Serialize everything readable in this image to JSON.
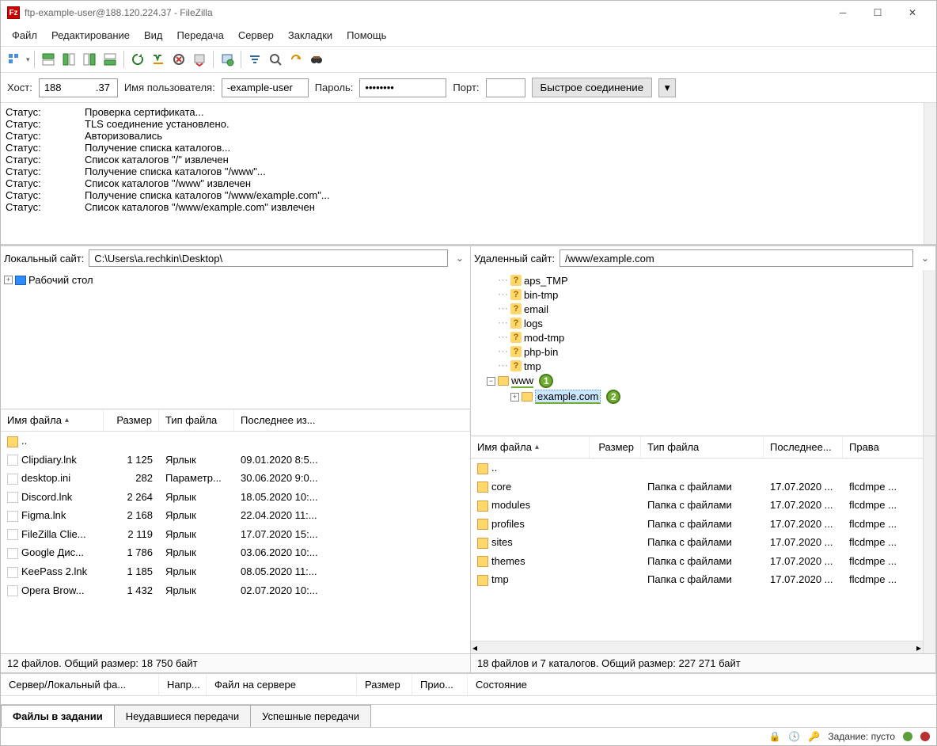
{
  "title": "ftp-example-user@188.120.224.37 - FileZilla",
  "menu": [
    "Файл",
    "Редактирование",
    "Вид",
    "Передача",
    "Сервер",
    "Закладки",
    "Помощь"
  ],
  "quick": {
    "host_label": "Хост:",
    "host": "188            .37",
    "user_label": "Имя пользователя:",
    "user": "-example-user",
    "pass_label": "Пароль:",
    "pass": "••••••••",
    "port_label": "Порт:",
    "port": "",
    "connect": "Быстрое соединение"
  },
  "log": [
    {
      "k": "Статус:",
      "v": "Проверка сертификата..."
    },
    {
      "k": "Статус:",
      "v": "TLS соединение установлено."
    },
    {
      "k": "Статус:",
      "v": "Авторизовались"
    },
    {
      "k": "Статус:",
      "v": "Получение списка каталогов..."
    },
    {
      "k": "Статус:",
      "v": "Список каталогов \"/\" извлечен"
    },
    {
      "k": "Статус:",
      "v": "Получение списка каталогов \"/www\"..."
    },
    {
      "k": "Статус:",
      "v": "Список каталогов \"/www\" извлечен"
    },
    {
      "k": "Статус:",
      "v": "Получение списка каталогов \"/www/example.com\"..."
    },
    {
      "k": "Статус:",
      "v": "Список каталогов \"/www/example.com\" извлечен"
    }
  ],
  "local": {
    "label": "Локальный сайт:",
    "path": "C:\\Users\\a.rechkin\\Desktop\\",
    "tree_root": "Рабочий стол",
    "cols": [
      "Имя файла",
      "Размер",
      "Тип файла",
      "Последнее из..."
    ],
    "rows": [
      {
        "n": "..",
        "s": "",
        "t": "",
        "d": ""
      },
      {
        "n": "Clipdiary.lnk",
        "s": "1 125",
        "t": "Ярлык",
        "d": "09.01.2020 8:5..."
      },
      {
        "n": "desktop.ini",
        "s": "282",
        "t": "Параметр...",
        "d": "30.06.2020 9:0..."
      },
      {
        "n": "Discord.lnk",
        "s": "2 264",
        "t": "Ярлык",
        "d": "18.05.2020 10:..."
      },
      {
        "n": "Figma.lnk",
        "s": "2 168",
        "t": "Ярлык",
        "d": "22.04.2020 11:..."
      },
      {
        "n": "FileZilla Clie...",
        "s": "2 119",
        "t": "Ярлык",
        "d": "17.07.2020 15:..."
      },
      {
        "n": "Google Дис...",
        "s": "1 786",
        "t": "Ярлык",
        "d": "03.06.2020 10:..."
      },
      {
        "n": "KeePass 2.lnk",
        "s": "1 185",
        "t": "Ярлык",
        "d": "08.05.2020 11:..."
      },
      {
        "n": "Opera Brow...",
        "s": "1 432",
        "t": "Ярлык",
        "d": "02.07.2020 10:..."
      }
    ],
    "status": "12 файлов. Общий размер: 18 750 байт"
  },
  "remote": {
    "label": "Удаленный сайт:",
    "path": "/www/example.com",
    "tree": [
      "aps_TMP",
      "bin-tmp",
      "email",
      "logs",
      "mod-tmp",
      "php-bin",
      "tmp"
    ],
    "tree_www": "www",
    "tree_example": "example.com",
    "badge1": "1",
    "badge2": "2",
    "cols": [
      "Имя файла",
      "Размер",
      "Тип файла",
      "Последнее...",
      "Права"
    ],
    "rows": [
      {
        "n": "..",
        "s": "",
        "t": "",
        "d": "",
        "p": ""
      },
      {
        "n": "core",
        "s": "",
        "t": "Папка с файлами",
        "d": "17.07.2020 ...",
        "p": "flcdmpe ..."
      },
      {
        "n": "modules",
        "s": "",
        "t": "Папка с файлами",
        "d": "17.07.2020 ...",
        "p": "flcdmpe ..."
      },
      {
        "n": "profiles",
        "s": "",
        "t": "Папка с файлами",
        "d": "17.07.2020 ...",
        "p": "flcdmpe ..."
      },
      {
        "n": "sites",
        "s": "",
        "t": "Папка с файлами",
        "d": "17.07.2020 ...",
        "p": "flcdmpe ..."
      },
      {
        "n": "themes",
        "s": "",
        "t": "Папка с файлами",
        "d": "17.07.2020 ...",
        "p": "flcdmpe ..."
      },
      {
        "n": "tmp",
        "s": "",
        "t": "Папка с файлами",
        "d": "17.07.2020 ...",
        "p": "flcdmpe ..."
      }
    ],
    "status": "18 файлов и 7 каталогов. Общий размер: 227 271 байт"
  },
  "queue_cols": [
    "Сервер/Локальный фа...",
    "Напр...",
    "Файл на сервере",
    "Размер",
    "Прио...",
    "Состояние"
  ],
  "tabs": [
    "Файлы в задании",
    "Неудавшиеся передачи",
    "Успешные передачи"
  ],
  "bottom": {
    "queue_label": "Задание: пусто"
  }
}
